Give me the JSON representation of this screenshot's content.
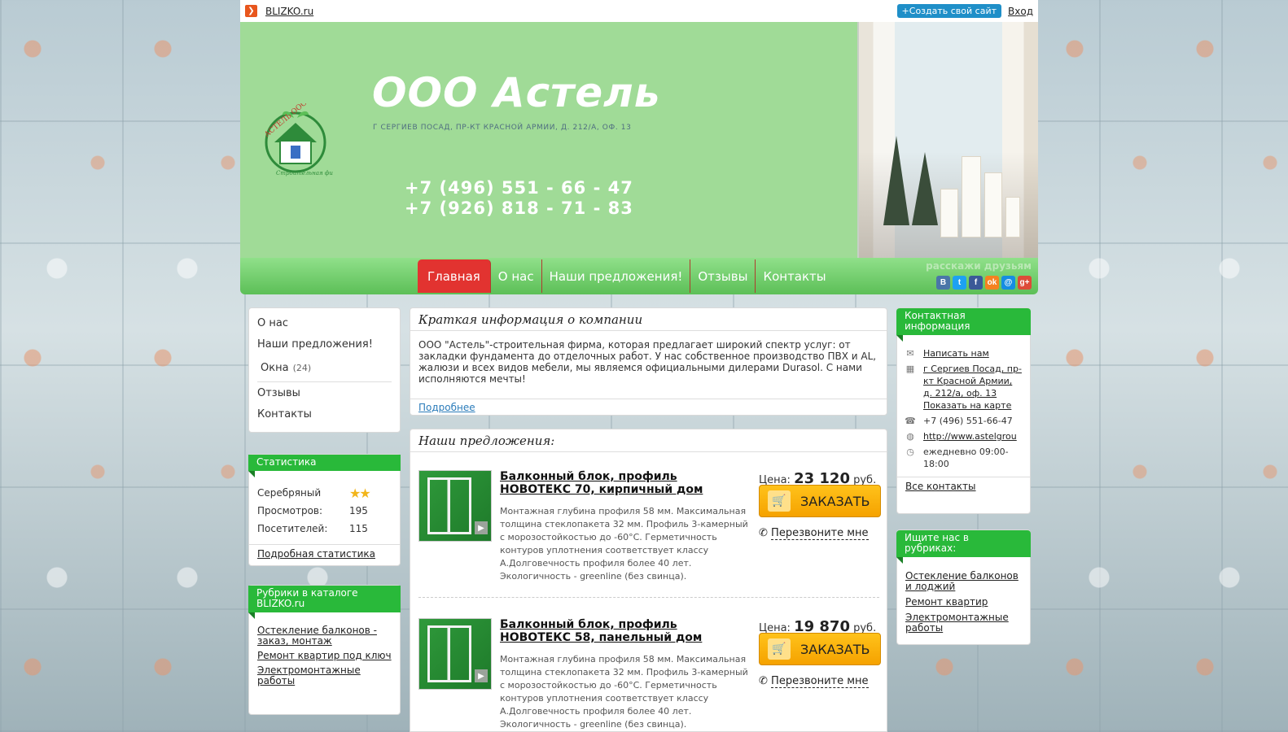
{
  "topbar": {
    "site": "BLIZKO.ru",
    "create_button": "+Создать свой сайт",
    "login": "Вход"
  },
  "header": {
    "company_name": "ООО Астель",
    "address": "Г СЕРГИЕВ ПОСАД, ПР-КТ КРАСНОЙ АРМИИ, Д. 212/А, ОФ. 13",
    "phones": [
      "+7 (496) 551 - 66 - 47",
      "+7 (926) 818 - 71 - 83"
    ],
    "logo_text_top": "АСТЕЛЬ ООО",
    "logo_text_bottom": "Строительная фирма"
  },
  "nav": {
    "items": [
      "Главная",
      "О нас",
      "Наши предложения!",
      "Отзывы",
      "Контакты"
    ],
    "active_index": 0
  },
  "share": {
    "label": "расскажи друзьям",
    "icons": [
      {
        "name": "vk-icon",
        "glyph": "В",
        "color": "#4a76a8"
      },
      {
        "name": "twitter-icon",
        "glyph": "t",
        "color": "#1da1f2"
      },
      {
        "name": "facebook-icon",
        "glyph": "f",
        "color": "#3b5998"
      },
      {
        "name": "odnoklassniki-icon",
        "glyph": "ok",
        "color": "#f58220"
      },
      {
        "name": "mail-icon",
        "glyph": "@",
        "color": "#168de2"
      },
      {
        "name": "googleplus-icon",
        "glyph": "g+",
        "color": "#dd4b39"
      }
    ]
  },
  "left_menu": {
    "items": [
      "О нас",
      "Наши предложения!"
    ],
    "sub_item": {
      "label": "Окна",
      "count": "(24)"
    },
    "items_after": [
      "Отзывы",
      "Контакты"
    ]
  },
  "stats": {
    "title": "Статистика",
    "level_label": "Серебряный",
    "stars": "★★",
    "views_label": "Просмотров:",
    "views": "195",
    "visitors_label": "Посетителей:",
    "visitors": "115",
    "more": "Подробная статистика"
  },
  "rubrics": {
    "title": "Рубрики в каталоге BLIZKO.ru",
    "links": [
      "Остекление балконов - заказ, монтаж",
      "Ремонт квартир под ключ",
      "Электромонтажные работы"
    ]
  },
  "info": {
    "title": "Краткая информация о компании",
    "text": "ООО \"Астель\"-строительная фирма, которая предлагает широкий спектр услуг: от закладки фундамента до отделочных работ. У нас собственное производство ПВХ и AL, жалюзи и всех видов мебели, мы являемся официальными дилерами Durasol. С нами исполняются мечты!",
    "more": "Подробнее"
  },
  "offers": {
    "title": "Наши предложения:",
    "price_label": "Цена:",
    "currency": "руб.",
    "order_label": "ЗАКАЗАТЬ",
    "callback_label": "Перезвоните мне",
    "items": [
      {
        "title": "Балконный блок, профиль НОВОТЕКС 70, кирпичный дом",
        "price": "23 120",
        "desc": "Монтажная глубина профиля 58 мм. Максимальная толщина стеклопакета 32 мм. Профиль 3-камерный с морозостойкостью до -60°С. Герметичность контуров уплотнения соответствует классу А.Долговечность профиля более 40 лет. Экологичность - greenline (без свинца)."
      },
      {
        "title": "Балконный блок, профиль НОВОТЕКС 58, панельный дом",
        "price": "19 870",
        "desc": "Монтажная глубина профиля 58 мм. Максимальная толщина стеклопакета 32 мм. Профиль 3-камерный с морозостойкостью до -60°С. Герметичность контуров уплотнения соответствует классу А.Долговечность профиля более 40 лет. Экологичность - greenline (без свинца)."
      }
    ]
  },
  "contacts": {
    "title": "Контактная информация",
    "write_us": "Написать нам",
    "address": "г Сергиев Посад, пр-кт Красной Армии, д. 212/а, оф. 13",
    "show_map": "Показать на карте",
    "phone": "+7 (496) 551-66-47",
    "website": "http://www.astelgrou",
    "hours": "ежедневно 09:00-18:00",
    "all": "Все контакты"
  },
  "find_us": {
    "title": "Ищите нас в рубриках:",
    "links": [
      "Остекление балконов и лоджий",
      "Ремонт квартир",
      "Электромонтажные работы"
    ]
  }
}
